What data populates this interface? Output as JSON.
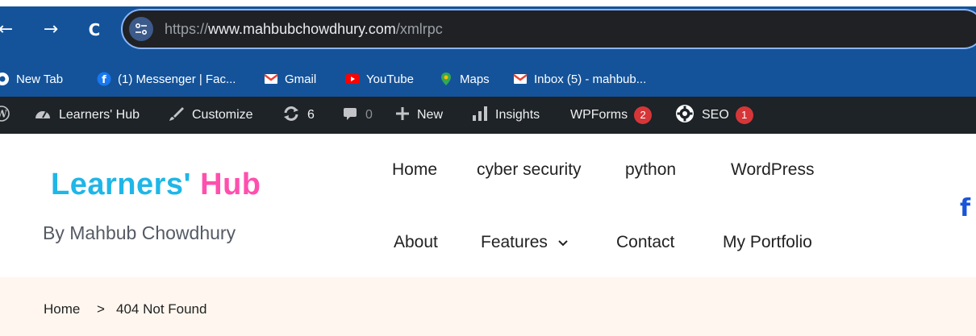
{
  "browser": {
    "url_scheme": "https://",
    "url_host": "www.mahbubchowdhury.com",
    "url_path": "/xmlrpc",
    "nav_back": "←",
    "nav_forward": "→",
    "nav_reload": "C"
  },
  "bookmarks": [
    {
      "label": "New Tab",
      "icon": "chrome-icon"
    },
    {
      "label": "(1) Messenger | Fac...",
      "icon": "facebook-icon"
    },
    {
      "label": "Gmail",
      "icon": "gmail-icon"
    },
    {
      "label": "YouTube",
      "icon": "youtube-icon"
    },
    {
      "label": "Maps",
      "icon": "maps-pin-icon"
    },
    {
      "label": "Inbox (5) - mahbub...",
      "icon": "gmail-icon"
    }
  ],
  "admin_bar": {
    "site_name": "Learners' Hub",
    "customize": "Customize",
    "updates_count": "6",
    "comments_count": "0",
    "new_label": "New",
    "insights": "Insights",
    "wpforms": "WPForms",
    "wpforms_badge": "2",
    "seo": "SEO",
    "seo_badge": "1"
  },
  "site": {
    "logo_part1": "Learners'",
    "logo_part2": "Hub",
    "tagline": "By Mahbub Chowdhury",
    "menu_row1": [
      "Home",
      "cyber security",
      "python",
      "WordPress"
    ],
    "menu_row2": [
      "About",
      "Features",
      "Contact",
      "My Portfolio"
    ],
    "social_icon": "f"
  },
  "breadcrumb": {
    "home": "Home",
    "separator": ">",
    "current": "404 Not Found"
  },
  "colors": {
    "browser_bar": "#14539a",
    "admin_bar": "#1d2327",
    "badge": "#d63638",
    "logo_blue": "#1fb6e8",
    "logo_pink": "#ff4fae",
    "breadcrumb_bg": "#fff7ef"
  }
}
